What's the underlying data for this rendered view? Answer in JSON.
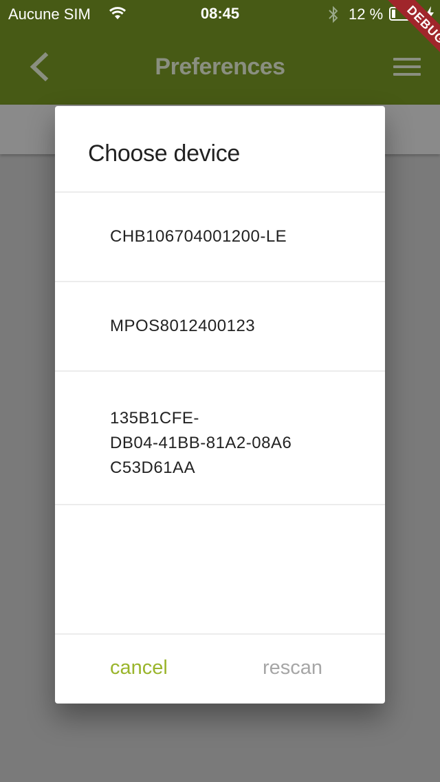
{
  "status_bar": {
    "carrier": "Aucune SIM",
    "time": "08:45",
    "battery": "12 %"
  },
  "app_bar": {
    "title": "Preferences",
    "debug_banner": "DEBUG"
  },
  "dialog": {
    "title": "Choose device",
    "devices": [
      "CHB106704001200-LE",
      "MPOS8012400123",
      "135B1CFE-\nDB04-41BB-81A2-08A6\nC53D61AA"
    ],
    "cancel_label": "cancel",
    "rescan_label": "rescan"
  },
  "colors": {
    "app_bar": "#475a15",
    "accent": "#9ab52c",
    "debug": "#a0262b",
    "disabled": "#a6a6a6"
  }
}
